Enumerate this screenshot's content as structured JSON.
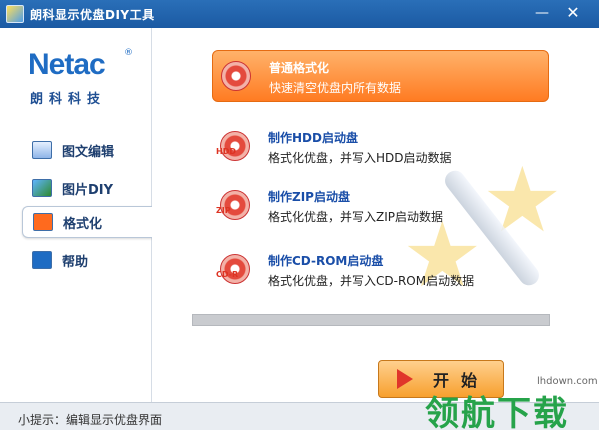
{
  "window": {
    "title": "朗科显示优盘DIY工具",
    "minimize": "—",
    "close": "✕"
  },
  "logo": {
    "brand": "Netac",
    "reg": "®",
    "sub": "朗科科技"
  },
  "nav": [
    {
      "label": "图文编辑"
    },
    {
      "label": "图片DIY"
    },
    {
      "label": "格式化",
      "active": true
    },
    {
      "label": "帮助"
    }
  ],
  "options": [
    {
      "title": "普通格式化",
      "desc": "快速清空优盘内所有数据",
      "selected": true
    },
    {
      "title": "制作HDD启动盘",
      "desc": "格式化优盘，并写入HDD启动数据",
      "tag": "HDD"
    },
    {
      "title": "制作ZIP启动盘",
      "desc": "格式化优盘，并写入ZIP启动数据",
      "tag": "ZIP"
    },
    {
      "title": "制作CD-ROM启动盘",
      "desc": "格式化优盘，并写入CD-ROM启动数据",
      "tag": "CD-R"
    }
  ],
  "progress": {
    "value": 0
  },
  "start_button": {
    "label": "开始"
  },
  "status": {
    "text": "小提示：编辑显示优盘界面"
  },
  "watermark": {
    "url": "lhdown.com",
    "text": "领航下载"
  },
  "colors": {
    "accent": "#ff7b22",
    "title_bar": "#1b5aa3",
    "progress": "#c9cbcf"
  }
}
